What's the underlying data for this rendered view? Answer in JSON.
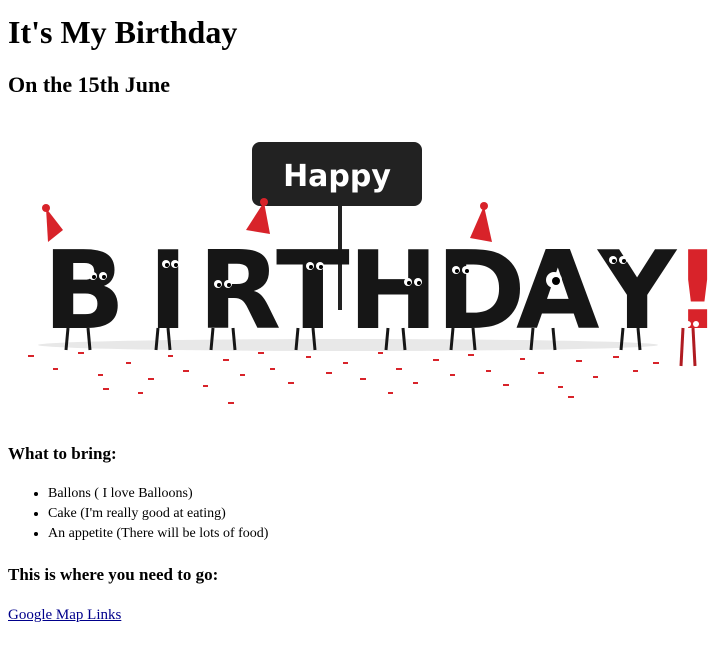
{
  "page": {
    "title": "It's My Birthday",
    "subtitle": "On the 15th June"
  },
  "banner": {
    "sign_text": "Happy",
    "letters": [
      "B",
      "I",
      "R",
      "T",
      "H",
      "D",
      "A",
      "Y",
      "!"
    ],
    "colors": {
      "letters": "#161616",
      "sign": "#222222",
      "accent_red": "#d8232a",
      "confetti": "#d8232a"
    }
  },
  "bring": {
    "heading": "What to bring:",
    "items": [
      "Ballons ( I love Balloons)",
      "Cake (I'm really good at eating)",
      "An appetite (There will be lots of food)"
    ]
  },
  "go": {
    "heading": "This is where you need to go:",
    "link_text": "Google Map Links"
  }
}
